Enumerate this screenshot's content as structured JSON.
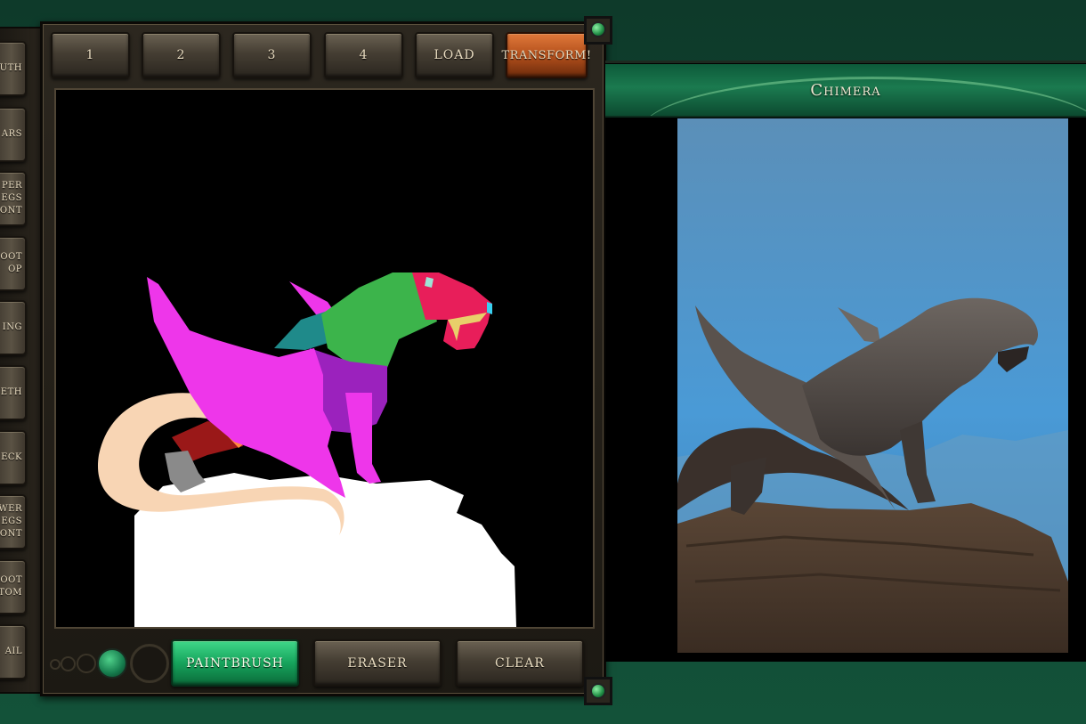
{
  "sidebar": {
    "items": [
      {
        "label": "OUTH"
      },
      {
        "label": "ARS"
      },
      {
        "label": "PER\nEGS\nONT"
      },
      {
        "label": "OOT\nOP"
      },
      {
        "label": "ING"
      },
      {
        "label": "ETH"
      },
      {
        "label": "ECK"
      },
      {
        "label": "WER\nEGS\nONT"
      },
      {
        "label": "OOT\nTTOM"
      },
      {
        "label": "AIL"
      }
    ]
  },
  "toolbar": {
    "slots": [
      "1",
      "2",
      "3",
      "4"
    ],
    "load_label": "LOAD",
    "transform_label": "TRANSFORM!"
  },
  "tools": {
    "paintbrush_label": "PAINTBRUSH",
    "eraser_label": "ERASER",
    "clear_label": "CLEAR",
    "active_tool": "paintbrush"
  },
  "result": {
    "title": "Chimera"
  },
  "colors": {
    "accent_green": "#1fa864",
    "transform_orange": "#c2561c",
    "mask_wing": "#ee36ea",
    "mask_head": "#e81e5a",
    "mask_neck": "#3cb44b",
    "mask_body": "#9b22bd",
    "mask_tail": "#f8d5b4",
    "mask_ground": "#ffffff"
  }
}
